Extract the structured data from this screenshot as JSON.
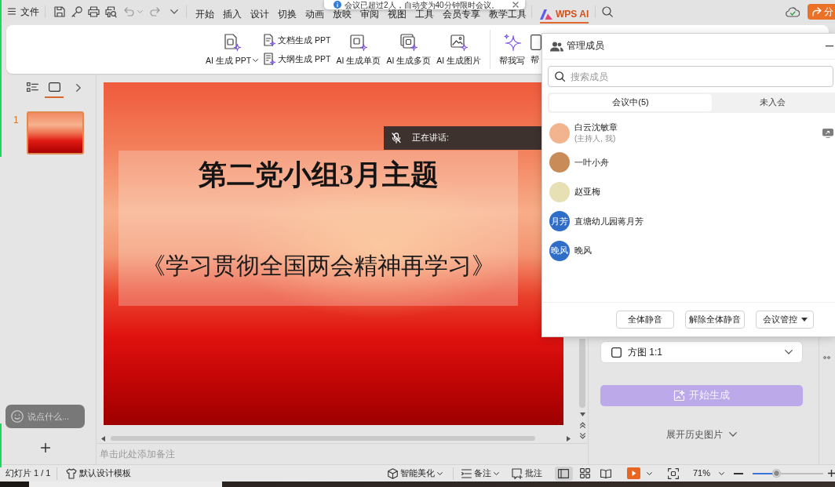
{
  "notification": {
    "text": "会议已超过2人，自动变为40分钟限时会议。"
  },
  "menu_bar": {
    "file_menu": "文件",
    "tabs": [
      {
        "label": "开始",
        "kind": "text",
        "selected": false
      },
      {
        "label": "插入",
        "kind": "text",
        "selected": false
      },
      {
        "label": "设计",
        "kind": "text",
        "selected": false
      },
      {
        "label": "切换",
        "kind": "text",
        "selected": false
      },
      {
        "label": "动画",
        "kind": "text",
        "selected": false
      },
      {
        "label": "放映",
        "kind": "text",
        "selected": false
      },
      {
        "label": "审阅",
        "kind": "text",
        "selected": false
      },
      {
        "label": "视图",
        "kind": "text",
        "selected": false
      },
      {
        "label": "工具",
        "kind": "text",
        "selected": false
      },
      {
        "label": "会员专享",
        "kind": "text",
        "selected": false
      },
      {
        "label": "教学工具",
        "kind": "text",
        "selected": false
      },
      {
        "label": "WPS AI",
        "kind": "ai",
        "selected": true
      }
    ],
    "share_button": "分"
  },
  "ribbon": {
    "groups": [
      {
        "items": [
          {
            "kind": "large",
            "label": "AI 生成 PPT",
            "dropdown": true
          },
          {
            "kind": "stack",
            "labels": [
              "文档生成 PPT",
              "大纲生成 PPT"
            ]
          },
          {
            "kind": "large",
            "label": "AI 生成单页"
          },
          {
            "kind": "large",
            "label": "AI 生成多页"
          },
          {
            "kind": "large",
            "label": "AI 生成图片"
          }
        ]
      },
      {
        "items": [
          {
            "kind": "large",
            "label": "帮我写"
          },
          {
            "kind": "large",
            "label": "帮"
          }
        ]
      }
    ]
  },
  "slide_panel": {
    "view_tabs": [
      {
        "selected": false
      },
      {
        "selected": true
      }
    ],
    "slides": [
      {
        "number": "1",
        "selected": true
      }
    ]
  },
  "chat_box": {
    "placeholder": "说点什么..."
  },
  "slide": {
    "title": "第二党小组3月主题",
    "subtitle": "《学习贯彻全国两会精神再学习》"
  },
  "speaker_banner": {
    "label": "正在讲话:"
  },
  "notes": {
    "placeholder": "单击此处添加备注"
  },
  "ai_image_panel": {
    "ratio": "方图 1:1",
    "generate_button": {
      "label": "开始生成",
      "disabled": true
    },
    "history_toggle": "展开历史图片"
  },
  "member_panel": {
    "title": "管理成员",
    "search": {
      "placeholder": "搜索成员"
    },
    "tabs": [
      {
        "label": "会议中(5)",
        "selected": true
      },
      {
        "label": "未入会",
        "selected": false
      }
    ],
    "members": [
      {
        "name": "白云沈敏章",
        "role": "(主持人, 我)",
        "avatar": {
          "kind": "photo"
        },
        "sharing": true
      },
      {
        "name": "一叶小舟",
        "avatar": {
          "kind": "photo"
        },
        "sharing": false
      },
      {
        "name": "赵亚梅",
        "avatar": {
          "kind": "photo"
        },
        "sharing": false
      },
      {
        "name": "直塘幼儿园蒋月芳",
        "avatar": {
          "kind": "initials",
          "text": "月芳"
        },
        "sharing": false
      },
      {
        "name": "晚风",
        "avatar": {
          "kind": "initials",
          "text": "晚风"
        },
        "sharing": false
      }
    ],
    "buttons": [
      {
        "label": "全体静音"
      },
      {
        "label": "解除全体静音"
      },
      {
        "label": "会议管控",
        "dropdown": true
      }
    ]
  },
  "status_bar": {
    "slide_count": "幻灯片 1 / 1",
    "template": "默认设计模板",
    "beautify": "智能美化",
    "notes": "备注",
    "comments": "批注",
    "views": [
      {
        "selected": true
      },
      {
        "selected": false
      },
      {
        "selected": false
      }
    ],
    "zoom": "71%",
    "zoom_slider": {
      "level": 0.34
    }
  }
}
